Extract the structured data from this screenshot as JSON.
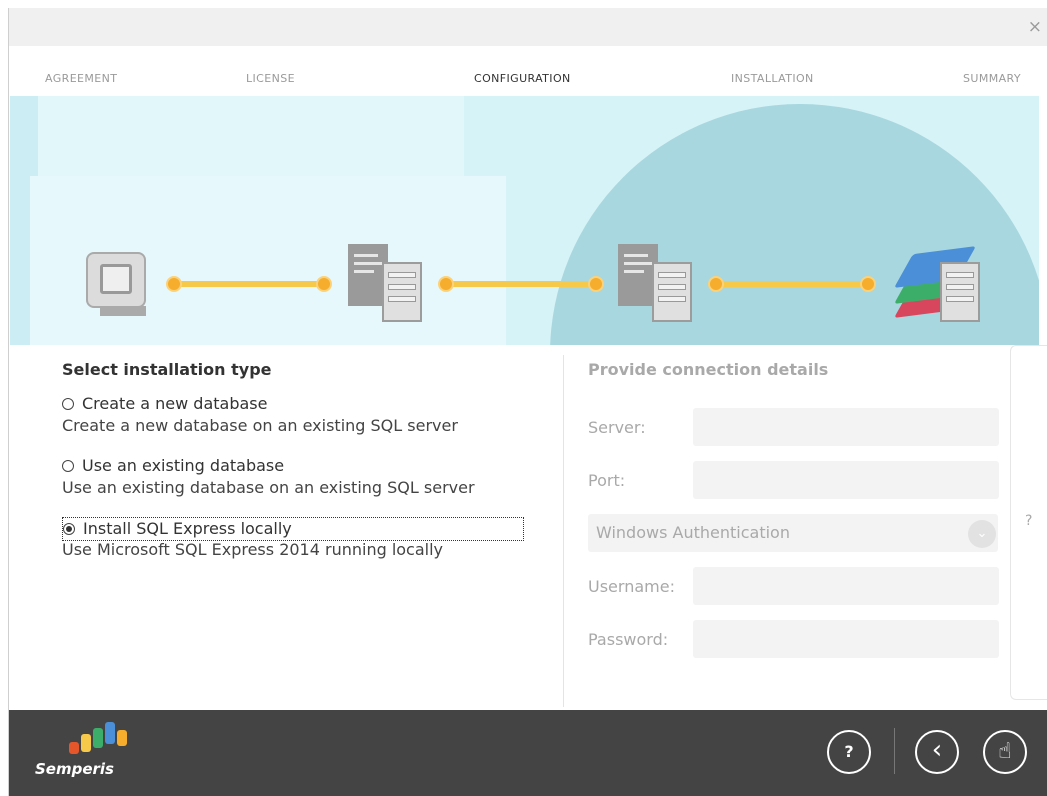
{
  "window": {
    "close_glyph": "×"
  },
  "steps": [
    {
      "label": "AGREEMENT",
      "state": "done",
      "bar_color": "#e5562b"
    },
    {
      "label": "LICENSE",
      "state": "done",
      "bar_color": "#f6c94a"
    },
    {
      "label": "CONFIGURATION",
      "state": "active",
      "bar_color": "#f6c94a"
    },
    {
      "label": "INSTALLATION",
      "state": "pending"
    },
    {
      "label": "SUMMARY",
      "state": "pending"
    }
  ],
  "banner_icons": [
    "computer-icon",
    "server-icon",
    "server-icon",
    "database-server-icon"
  ],
  "install_type": {
    "title": "Select installation type",
    "options": [
      {
        "label": "Create a new database",
        "description": "Create a new database on an existing SQL server",
        "selected": false
      },
      {
        "label": "Use an existing database",
        "description": "Use an existing database on an existing SQL server",
        "selected": false
      },
      {
        "label": "Install SQL Express locally",
        "description": "Use Microsoft SQL Express 2014 running locally",
        "selected": true
      }
    ]
  },
  "connection": {
    "title": "Provide connection details",
    "server_label": "Server:",
    "server_value": "",
    "port_label": "Port:",
    "port_value": "",
    "auth_selected": "Windows Authentication",
    "username_label": "Username:",
    "username_value": "",
    "password_label": "Password:",
    "password_value": ""
  },
  "side_help_glyph": "?",
  "footer": {
    "brand": "Semperis",
    "help_glyph": "?",
    "back_glyph": "‹",
    "next_glyph": "☝"
  },
  "colors": {
    "accent_orange": "#e5562b",
    "accent_yellow": "#f6c94a",
    "footer_bg": "#444444",
    "banner_bg": "#d6f3f7"
  }
}
